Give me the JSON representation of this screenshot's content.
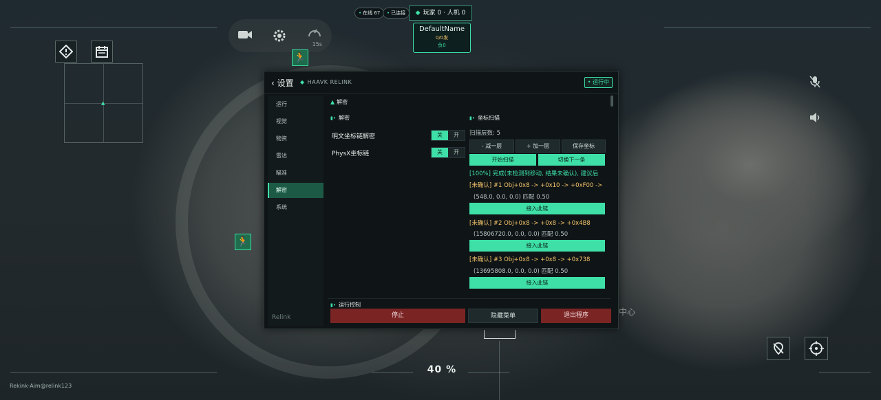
{
  "top": {
    "online": "在线 67",
    "connected": "已连接",
    "players": "玩家 0 · 人机 0",
    "target_name": "DefaultName",
    "target_stat": "0/0发",
    "target_sub": "负0",
    "timer": "15s"
  },
  "panel": {
    "back": "设置",
    "brand": "HAAVK RELINK",
    "running": "运行中",
    "sidebar": [
      "运行",
      "视觉",
      "物资",
      "雷达",
      "瞄准",
      "解密",
      "系统"
    ],
    "active_index": 5,
    "sidebar_footer": "Relink",
    "section_title": "解密",
    "left": {
      "title": "解密",
      "rows": [
        {
          "label": "明文坐标链解密",
          "on": "关",
          "off": "开"
        },
        {
          "label": "PhysX坐标链",
          "on": "关",
          "off": "开"
        }
      ]
    },
    "right": {
      "title": "坐标扫描",
      "depth": "扫描层数: 5",
      "btn_minus": "- 减一层",
      "btn_plus": "+ 加一层",
      "btn_save": "保存坐标",
      "btn_scan": "开始扫描",
      "btn_next": "切换下一条",
      "status": "[100%] 完成(未检测到移动, 结果未确认), 建议后",
      "results": [
        {
          "chain": "[未确认] #1 Obj+0x8 -> +0x10 -> +0xF00 ->",
          "coords": "(548.0, 0.0, 0.0) 匹配 0.50",
          "btn": "接入此链"
        },
        {
          "chain": "[未确认] #2 Obj+0x8 -> +0x8 -> +0x4B8",
          "coords": "(15806720.0, 0.0, 0.0) 匹配 0.50",
          "btn": "接入此链"
        },
        {
          "chain": "[未确认] #3 Obj+0x8 -> +0x8 -> +0x738",
          "coords": "(13695808.0, 0.0, 0.0) 匹配 0.50",
          "btn": "接入此链"
        }
      ]
    },
    "control": {
      "title": "运行控制",
      "stop": "停止",
      "hide": "隐藏菜单",
      "exit": "退出程序"
    }
  },
  "hud": {
    "zoom": "40 %",
    "credit": "Rekink·Aim@relink123",
    "map_label": "中心"
  },
  "colors": {
    "accent": "#3ee0a8",
    "danger": "#7a2424",
    "warning": "#f2c46a"
  },
  "icons": [
    "alert-icon",
    "calendar-icon",
    "camera-icon",
    "gear-icon",
    "timer-icon",
    "runner-icon",
    "mic-muted-icon",
    "speaker-icon",
    "pin-off-icon",
    "crosshair-icon",
    "chevron-left-icon"
  ]
}
